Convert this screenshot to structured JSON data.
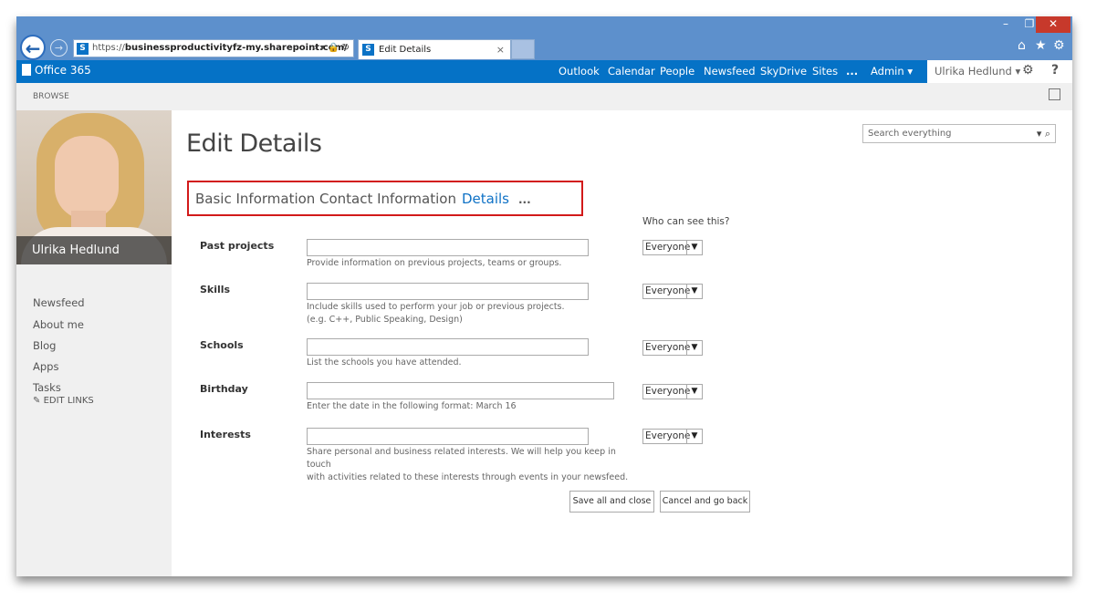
{
  "browser": {
    "url_prefix": "https://",
    "url_domain": "businessproductivityfz-my.sharepoint.com/",
    "tab_title": "Edit Details",
    "tab_close": "×"
  },
  "suite_bar": {
    "brand": "Office 365",
    "nav": [
      "Outlook",
      "Calendar",
      "People",
      "Newsfeed",
      "SkyDrive",
      "Sites",
      "...",
      "Admin"
    ],
    "user": "Ulrika Hedlund",
    "help": "?"
  },
  "ribbon": {
    "browse": "BROWSE"
  },
  "profile": {
    "name": "Ulrika Hedlund",
    "nav": [
      "Newsfeed",
      "About me",
      "Blog",
      "Apps",
      "Tasks"
    ],
    "edit_links": "EDIT LINKS"
  },
  "page": {
    "title": "Edit Details",
    "tabs": [
      "Basic Information",
      "Contact Information",
      "Details",
      "..."
    ],
    "search_placeholder": "Search everything",
    "who_can_see": "Who can see this?"
  },
  "fields": [
    {
      "label": "Past projects",
      "hint": [
        "Provide information on previous projects, teams or groups."
      ],
      "visibility": "Everyone"
    },
    {
      "label": "Skills",
      "hint": [
        "Include skills used to perform your job or previous projects.",
        "(e.g. C++, Public Speaking, Design)"
      ],
      "visibility": "Everyone"
    },
    {
      "label": "Schools",
      "hint": [
        "List the schools you have attended."
      ],
      "visibility": "Everyone"
    },
    {
      "label": "Birthday",
      "hint": [
        "Enter the date in the following format: March 16"
      ],
      "visibility": "Everyone"
    },
    {
      "label": "Interests",
      "hint": [
        "Share personal and business related interests. We will help you keep in touch",
        "with activities related to these interests through events in your newsfeed."
      ],
      "visibility": "Everyone"
    }
  ],
  "buttons": {
    "save": "Save all and close",
    "cancel": "Cancel and go back"
  },
  "colors": {
    "suite_blue": "#0572c6",
    "highlight_red": "#d21a1a",
    "active_tab": "#0f72c6"
  }
}
